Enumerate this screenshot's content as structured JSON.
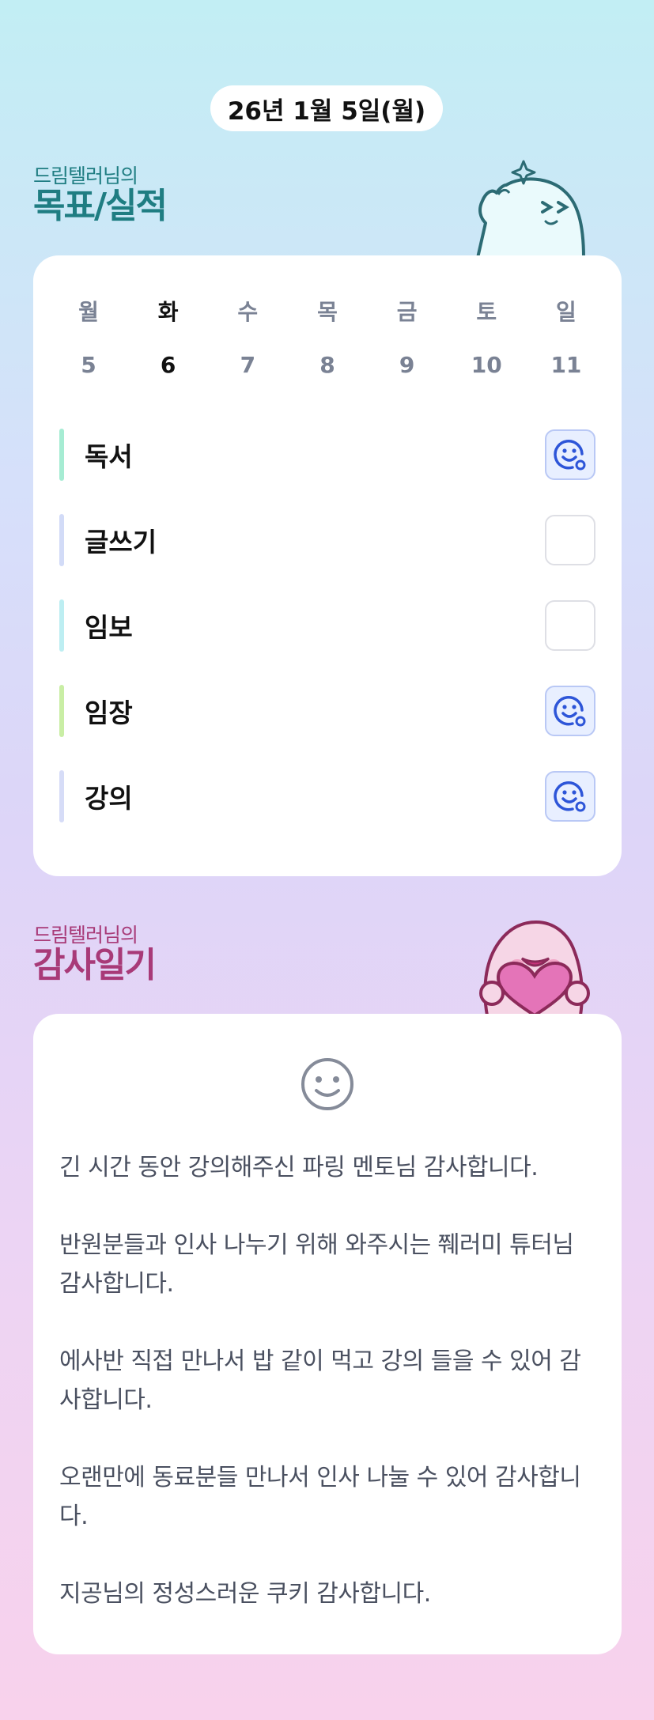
{
  "date": "26년 1월 5일(월)",
  "goal_section": {
    "subtitle": "드림텔러님의",
    "title": "목표/실적"
  },
  "week": {
    "days": [
      {
        "name": "월",
        "num": "5"
      },
      {
        "name": "화",
        "num": "6"
      },
      {
        "name": "수",
        "num": "7"
      },
      {
        "name": "목",
        "num": "8"
      },
      {
        "name": "금",
        "num": "9"
      },
      {
        "name": "토",
        "num": "10"
      },
      {
        "name": "일",
        "num": "11"
      }
    ],
    "active_index": 1
  },
  "goals": [
    {
      "label": "독서",
      "checked": true,
      "color": "#a6ecd3"
    },
    {
      "label": "글쓰기",
      "checked": false,
      "color": "#d2dbf7"
    },
    {
      "label": "임보",
      "checked": false,
      "color": "#bdeef2"
    },
    {
      "label": "임장",
      "checked": true,
      "color": "#c9eea5"
    },
    {
      "label": "강의",
      "checked": true,
      "color": "#d6dcf7"
    }
  ],
  "gratitude_section": {
    "subtitle": "드림텔러님의",
    "title": "감사일기"
  },
  "gratitude": {
    "icon": "smile-face-icon",
    "entries": [
      "긴 시간 동안 강의해주신 파링 멘토님 감사합니다.",
      "반원분들과 인사 나누기 위해 와주시는 쮀러미 튜터님 감사합니다.",
      "에사반 직접 만나서 밥 같이 먹고 강의 들을 수 있어 감사합니다.",
      "오랜만에 동료분들 만나서 인사 나눌 수 있어 감사합니다.",
      "지공님의 정성스러운 쿠키 감사합니다."
    ]
  },
  "colors": {
    "goal_title": "#1f7d82",
    "gratitude_title": "#a83a78",
    "check_accent": "#2d55d8"
  }
}
